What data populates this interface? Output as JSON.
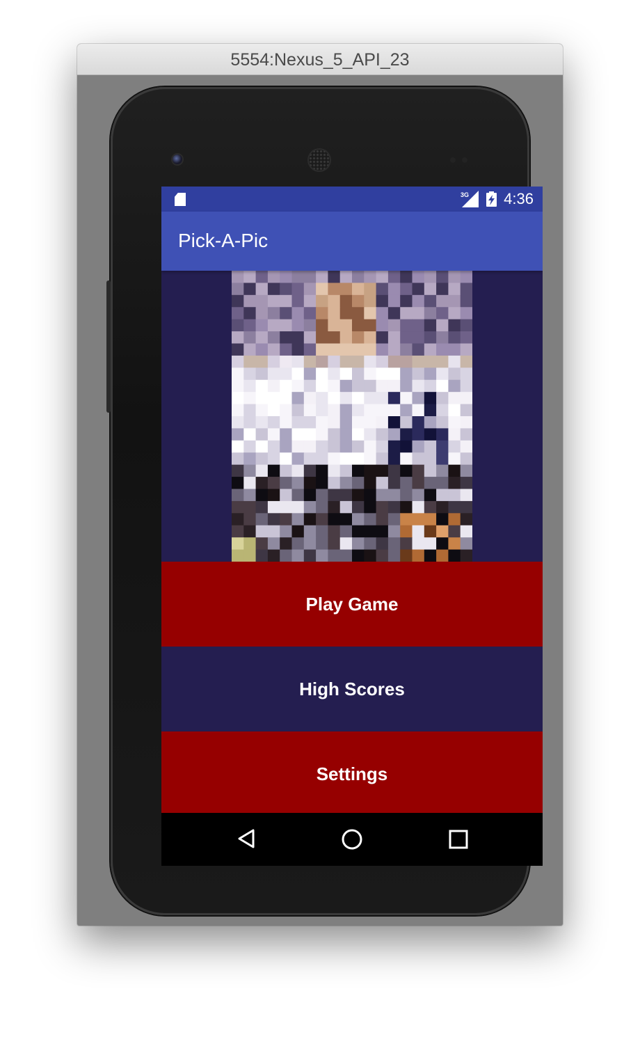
{
  "window": {
    "title": "5554:Nexus_5_API_23"
  },
  "statusbar": {
    "time": "4:36",
    "network": "3G",
    "icons": [
      "sd-card-icon",
      "signal-icon",
      "battery-icon"
    ]
  },
  "app": {
    "title": "Pick-A-Pic"
  },
  "menu": {
    "play_label": "Play Game",
    "scores_label": "High Scores",
    "settings_label": "Settings"
  },
  "navbar": {
    "icons": [
      "back-icon",
      "home-icon",
      "recents-icon"
    ]
  },
  "colors": {
    "statusbar": "#303f9f",
    "appbar": "#3f51b5",
    "primary_button": "#960000",
    "secondary_button": "#241e50"
  }
}
